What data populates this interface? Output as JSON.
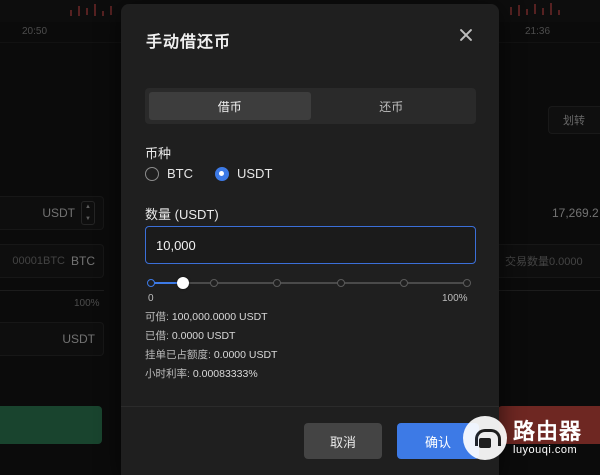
{
  "background": {
    "time_left": "20:50",
    "time_right": "21:36",
    "left_panel": {
      "price_field_unit": "USDT",
      "amount_field_value": "00001BTC",
      "amount_field_unit": "BTC",
      "percent_label": "100%",
      "total_field_unit": "USDT"
    },
    "right_panel": {
      "transfer_button": "划转",
      "price_value": "17,269.2",
      "amount_placeholder": "交易数量0.0000"
    }
  },
  "modal": {
    "title": "手动借还币",
    "tabs": [
      {
        "label": "借币",
        "active": true
      },
      {
        "label": "还币",
        "active": false
      }
    ],
    "currency_label": "币种",
    "currency_options": [
      {
        "label": "BTC",
        "checked": false
      },
      {
        "label": "USDT",
        "checked": true
      }
    ],
    "amount_label": "数量 (USDT)",
    "amount_value": "10,000",
    "slider": {
      "value_fraction": 0.1,
      "nodes_count": 6,
      "min_label": "0",
      "max_label": "100%"
    },
    "info": {
      "borrowable_key": "可借:",
      "borrowable_value": "100,000.0000 USDT",
      "borrowed_key": "已借:",
      "borrowed_value": "0.0000 USDT",
      "pending_key": "挂单已占额度:",
      "pending_value": "0.0000 USDT",
      "rate_key": "小时利率:",
      "rate_value": "0.00083333%"
    },
    "cancel_label": "取消",
    "confirm_label": "确认"
  },
  "watermark": {
    "cn": "路由器",
    "en": "luyouqi.com"
  },
  "colors": {
    "accent": "#3d7ae6",
    "buy_green": "#2f7d54",
    "sell_red": "#c9483f"
  }
}
